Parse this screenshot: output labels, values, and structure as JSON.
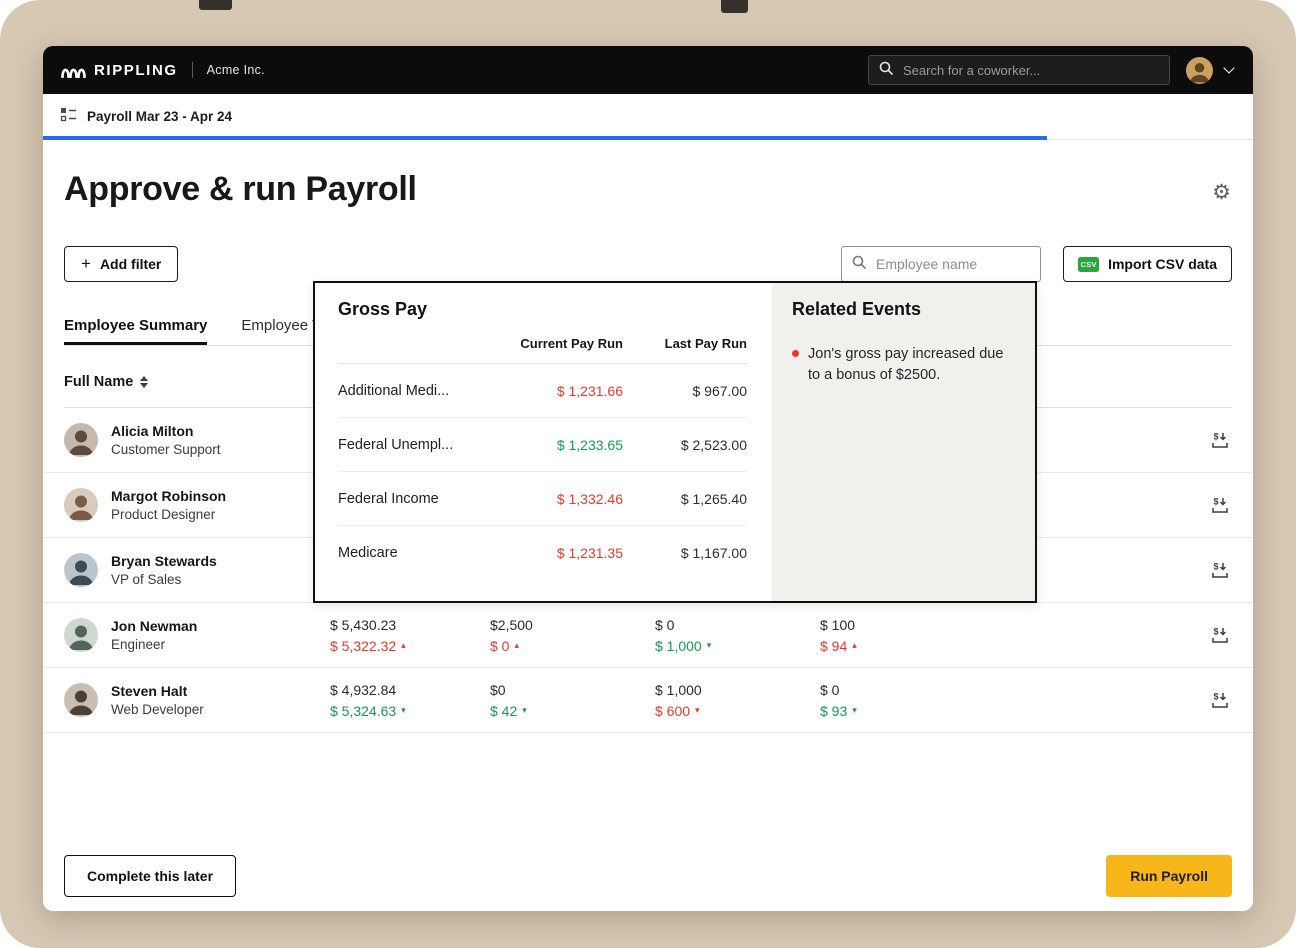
{
  "colors": {
    "frame_bg": "#d6c8b3",
    "topbar_bg": "#0c0c0c",
    "accent_blue": "#2a6ae8",
    "red": "#e23b2c",
    "green": "#169a51",
    "yellow": "#f7b71b",
    "csv_green": "#2aa63c"
  },
  "icons": {
    "gear": "⚙",
    "plus": "+"
  },
  "topbar": {
    "brand": "RIPPLING",
    "company": "Acme Inc.",
    "search_placeholder": "Search for a coworker..."
  },
  "stepbar": {
    "label": "Payroll Mar 23 - Apr 24",
    "progress_pct": 83
  },
  "page": {
    "title": "Approve & run Payroll"
  },
  "toolbar": {
    "add_filter_label": "Add filter",
    "employee_search_placeholder": "Employee name",
    "import_csv_label": "Import CSV data",
    "csv_badge": "CSV"
  },
  "tabs": [
    {
      "label": "Employee Summary",
      "active": true
    },
    {
      "label": "Employee T",
      "active": false
    }
  ],
  "table": {
    "name_header": "Full Name",
    "rows": [
      {
        "name": "Alicia Milton",
        "role": "Customer Support",
        "cells": []
      },
      {
        "name": "Margot Robinson",
        "role": "Product Designer",
        "cells": []
      },
      {
        "name": "Bryan Stewards",
        "role": "VP of Sales",
        "cells": []
      },
      {
        "name": "Jon Newman",
        "role": "Engineer",
        "cells": [
          {
            "top": "$ 5,430.23",
            "bottom": "$ 5,322.32",
            "arrow": "▴",
            "tone": "red"
          },
          {
            "top": "$2,500",
            "bottom": "$ 0",
            "arrow": "▴",
            "tone": "red"
          },
          {
            "top": "$ 0",
            "bottom": "$ 1,000",
            "arrow": "▾",
            "tone": "green"
          },
          {
            "top": "$ 100",
            "bottom": "$ 94",
            "arrow": "▴",
            "tone": "red"
          }
        ]
      },
      {
        "name": "Steven Halt",
        "role": "Web Developer",
        "cells": [
          {
            "top": "$ 4,932.84",
            "bottom": "$ 5,324.63",
            "arrow": "▾",
            "tone": "green"
          },
          {
            "top": "$0",
            "bottom": "$ 42",
            "arrow": "▾",
            "tone": "green"
          },
          {
            "top": "$ 1,000",
            "bottom": "$ 600",
            "arrow": "▾",
            "tone": "red"
          },
          {
            "top": "$ 0",
            "bottom": "$ 93",
            "arrow": "▾",
            "tone": "green"
          }
        ]
      }
    ]
  },
  "popup": {
    "gross_pay": {
      "title": "Gross Pay",
      "columns": [
        "Current Pay Run",
        "Last Pay Run"
      ],
      "rows": [
        {
          "label": "Additional Medi...",
          "current": "$ 1,231.66",
          "tone": "red",
          "last": "$ 967.00"
        },
        {
          "label": "Federal Unempl...",
          "current": "$ 1,233.65",
          "tone": "green",
          "last": "$ 2,523.00"
        },
        {
          "label": "Federal Income",
          "current": "$ 1,332.46",
          "tone": "red",
          "last": "$ 1,265.40"
        },
        {
          "label": "Medicare",
          "current": "$ 1,231.35",
          "tone": "red",
          "last": "$ 1,167.00"
        }
      ]
    },
    "related_events": {
      "title": "Related Events",
      "items": [
        "Jon's gross pay increased due to a bonus of $2500."
      ]
    }
  },
  "footer": {
    "secondary_label": "Complete this later",
    "primary_label": "Run Payroll"
  }
}
